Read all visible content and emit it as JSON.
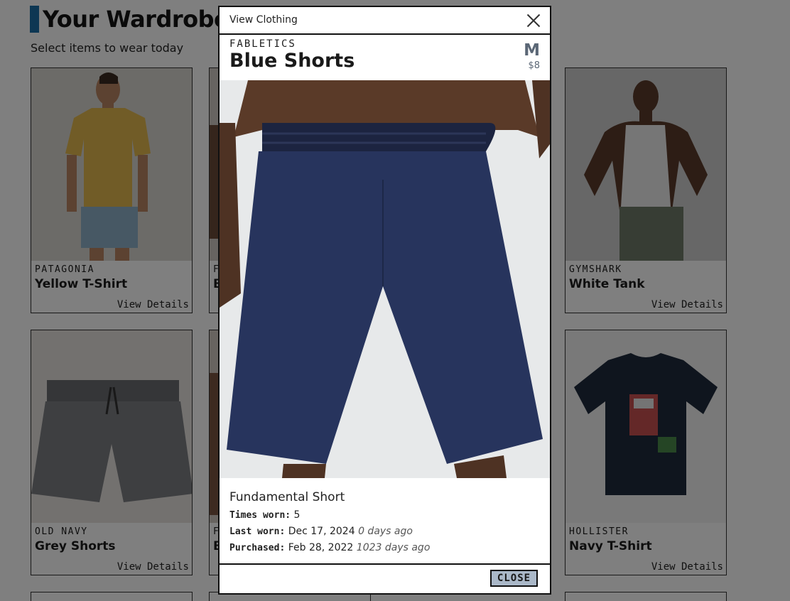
{
  "page": {
    "title": "Your Wardrobe",
    "subtitle": "Select items to wear today",
    "accent": "#1b6fa6"
  },
  "cards": [
    {
      "brand": "PATAGONIA",
      "name": "Yellow T-Shirt",
      "details": "View Details",
      "icon": "yellow-tshirt-photo"
    },
    {
      "brand": "F",
      "name": "B",
      "details": "",
      "icon": "partial-card-photo"
    },
    {
      "brand": "GYMSHARK",
      "name": "White Tank",
      "details": "View Details",
      "icon": "white-tank-photo"
    },
    {
      "brand": "OLD NAVY",
      "name": "Grey Shorts",
      "details": "View Details",
      "icon": "grey-shorts-photo"
    },
    {
      "brand": "F",
      "name": "B",
      "details": "",
      "icon": "partial-card-photo"
    },
    {
      "brand": "HOLLISTER",
      "name": "Navy T-Shirt",
      "details": "View Details",
      "icon": "navy-tshirt-photo"
    }
  ],
  "modal": {
    "title": "View Clothing",
    "brand": "FABLETICS",
    "name": "Blue Shorts",
    "size": "M",
    "price": "$8",
    "model": "Fundamental Short",
    "times_worn_label": "Times worn:",
    "times_worn": "5",
    "last_worn_label": "Last worn:",
    "last_worn": "Dec 17, 2024",
    "last_worn_ago": "0 days ago",
    "purchased_label": "Purchased:",
    "purchased": "Feb 28, 2022",
    "purchased_ago": "1023 days ago",
    "close_label": "CLOSE",
    "size_color": "#5b6776",
    "button_color": "#aab8c8"
  }
}
